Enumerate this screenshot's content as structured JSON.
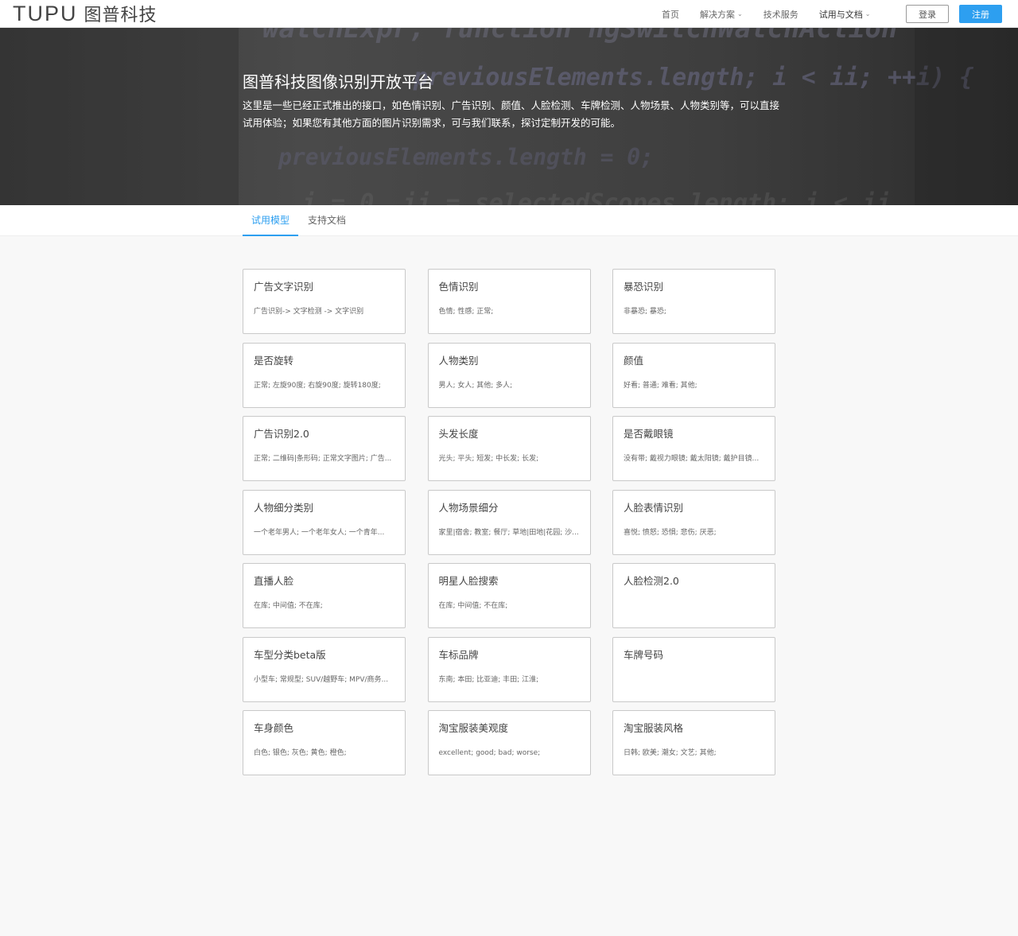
{
  "header": {
    "logo_latin": "TUPU",
    "logo_cn": "图普科技",
    "nav": [
      {
        "label": "首页",
        "dropdown": false
      },
      {
        "label": "解决方案",
        "dropdown": true
      },
      {
        "label": "技术服务",
        "dropdown": false
      },
      {
        "label": "试用与文档",
        "dropdown": true
      }
    ],
    "login_label": "登录",
    "register_label": "注册"
  },
  "hero": {
    "title": "图普科技图像识别开放平台",
    "description": "这里是一些已经正式推出的接口，如色情识别、广告识别、颜值、人脸检测、车牌检测、人物场景、人物类别等，可以直接试用体验；如果您有其他方面的图片识别需求，可与我们联系，探讨定制开发的可能。"
  },
  "tabs": [
    {
      "label": "试用模型",
      "active": true
    },
    {
      "label": "支持文档",
      "active": false
    }
  ],
  "cards": [
    {
      "title": "广告文字识别",
      "desc": "广告识别-> 文字检测 -> 文字识别"
    },
    {
      "title": "色情识别",
      "desc": "色情; 性感; 正常;"
    },
    {
      "title": "暴恐识别",
      "desc": "非暴恐; 暴恐;"
    },
    {
      "title": "是否旋转",
      "desc": "正常; 左旋90度; 右旋90度; 旋转180度;"
    },
    {
      "title": "人物类别",
      "desc": "男人; 女人; 其他; 多人;"
    },
    {
      "title": "颜值",
      "desc": "好看; 普通; 难看; 其他;"
    },
    {
      "title": "广告识别2.0",
      "desc": "正常; 二维码|条形码; 正常文字图片; 广告..."
    },
    {
      "title": "头发长度",
      "desc": "光头; 平头; 短发; 中长发; 长发;"
    },
    {
      "title": "是否戴眼镜",
      "desc": "没有带; 戴视力眼镜; 戴太阳镜; 戴护目镜..."
    },
    {
      "title": "人物细分类别",
      "desc": "一个老年男人; 一个老年女人; 一个青年..."
    },
    {
      "title": "人物场景细分",
      "desc": "家里|宿舍; 教室; 餐厅; 草地|田地|花园; 沙..."
    },
    {
      "title": "人脸表情识别",
      "desc": "喜悦; 愤怒; 恐惧; 悲伤; 厌恶;"
    },
    {
      "title": "直播人脸",
      "desc": "在库; 中间值; 不在库;"
    },
    {
      "title": "明星人脸搜索",
      "desc": "在库; 中间值; 不在库;"
    },
    {
      "title": "人脸检测2.0",
      "desc": ""
    },
    {
      "title": "车型分类beta版",
      "desc": "小型车; 常规型; SUV/越野车; MPV/商务..."
    },
    {
      "title": "车标品牌",
      "desc": "东南; 本田; 比亚迪; 丰田; 江淮;"
    },
    {
      "title": "车牌号码",
      "desc": ""
    },
    {
      "title": "车身颜色",
      "desc": "白色; 银色; 灰色; 黄色; 橙色;"
    },
    {
      "title": "淘宝服装美观度",
      "desc": "excellent; good; bad; worse;"
    },
    {
      "title": "淘宝服装风格",
      "desc": "日韩; 欧美; 潮女; 文艺; 其他;"
    }
  ],
  "colors": {
    "accent": "#2d9ff0",
    "card_border": "#c9c9c9",
    "page_bg": "#f8f8f8"
  }
}
